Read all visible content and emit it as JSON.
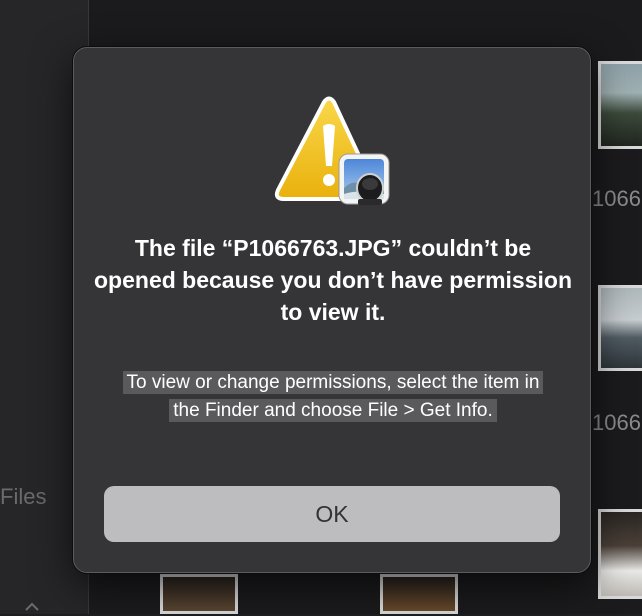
{
  "background": {
    "sidebar_label": "Files",
    "thumb_caption_1": "1066",
    "thumb_caption_2": "1066"
  },
  "alert": {
    "icon": "caution-triangle-with-preview-icon",
    "title": "The file “P1066763.JPG” couldn’t be opened because you don’t have permission to view it.",
    "message": "To view or change permissions, select the item in the Finder and choose File > Get Info.",
    "ok_label": "OK"
  },
  "colors": {
    "dialog_background": "#353537",
    "button_background": "#bdbdbf",
    "warning_yellow": "#f2c211",
    "selection_highlight": "#5a5a5c"
  }
}
